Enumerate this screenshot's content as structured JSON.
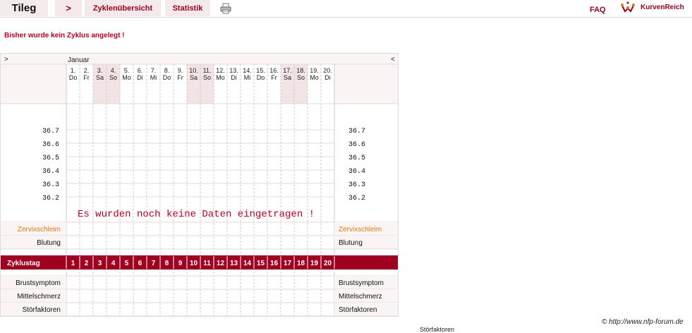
{
  "header": {
    "brand": "Tileg",
    "arrow": ">",
    "tabs": [
      {
        "label": "Zyklenübersicht"
      },
      {
        "label": "Statistik"
      }
    ],
    "faq": "FAQ",
    "logo_text": "KurvenReich"
  },
  "notice": "Bisher wurde kein Zyklus angelegt !",
  "chart": {
    "nav_prev": ">",
    "nav_next": "<",
    "month": "Januar",
    "days": [
      {
        "n": "1.",
        "wd": "Do",
        "weekend": false
      },
      {
        "n": "2.",
        "wd": "Fr",
        "weekend": false
      },
      {
        "n": "3.",
        "wd": "Sa",
        "weekend": true
      },
      {
        "n": "4.",
        "wd": "So",
        "weekend": true
      },
      {
        "n": "5.",
        "wd": "Mo",
        "weekend": false
      },
      {
        "n": "6.",
        "wd": "Di",
        "weekend": false
      },
      {
        "n": "7.",
        "wd": "Mi",
        "weekend": false
      },
      {
        "n": "8.",
        "wd": "Do",
        "weekend": false
      },
      {
        "n": "9.",
        "wd": "Fr",
        "weekend": false
      },
      {
        "n": "10.",
        "wd": "Sa",
        "weekend": true
      },
      {
        "n": "11.",
        "wd": "So",
        "weekend": true
      },
      {
        "n": "12.",
        "wd": "Mo",
        "weekend": false
      },
      {
        "n": "13.",
        "wd": "Di",
        "weekend": false
      },
      {
        "n": "14.",
        "wd": "Mi",
        "weekend": false
      },
      {
        "n": "15.",
        "wd": "Do",
        "weekend": false
      },
      {
        "n": "16.",
        "wd": "Fr",
        "weekend": false
      },
      {
        "n": "17.",
        "wd": "Sa",
        "weekend": true
      },
      {
        "n": "18.",
        "wd": "So",
        "weekend": true
      },
      {
        "n": "19.",
        "wd": "Mo",
        "weekend": false
      },
      {
        "n": "20.",
        "wd": "Di",
        "weekend": false
      }
    ],
    "temps": [
      "36.7",
      "36.6",
      "36.5",
      "36.4",
      "36.3",
      "36.2"
    ],
    "no_data": "Es wurden noch keine Daten eingetragen !",
    "rows_mid": [
      "Zervixschleim",
      "Blutung"
    ],
    "cycle_label": "Zyklustag",
    "cycle_days": [
      "1",
      "2",
      "3",
      "4",
      "5",
      "6",
      "7",
      "8",
      "9",
      "10",
      "11",
      "12",
      "13",
      "14",
      "15",
      "16",
      "17",
      "18",
      "19",
      "20"
    ],
    "rows_bottom": [
      "Brustsymptom",
      "Mittelschmerz",
      "Störfaktoren"
    ],
    "colors": {
      "accent": "#a00020",
      "orange": "#e07a10",
      "weekend": "#f2e3e5",
      "panel": "#fbf4f4"
    }
  },
  "copyright": "© http://www.nfp-forum.de",
  "stray_text": "Störfaktoren"
}
